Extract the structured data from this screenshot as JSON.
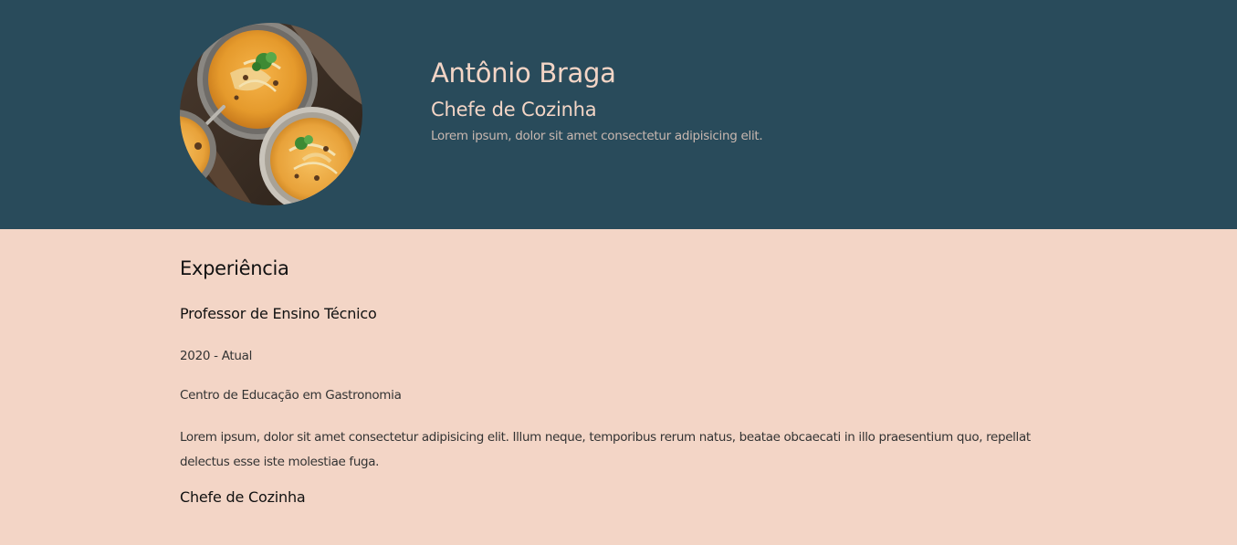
{
  "profile": {
    "photo_icon": "soup-bowls-photo",
    "name": "Antônio Braga",
    "role": "Chefe de Cozinha",
    "tagline": "Lorem ipsum, dolor sit amet consectetur adipisicing elit."
  },
  "experience": {
    "title": "Experiência",
    "jobs": [
      {
        "title": "Professor de Ensino Técnico",
        "period": "2020 - Atual",
        "place": "Centro de Educação em Gastronomia",
        "description": "Lorem ipsum, dolor sit amet consectetur adipisicing elit. Illum neque, temporibus rerum natus, beatae obcaecati in illo praesentium quo, repellat delectus esse iste molestiae fuga."
      },
      {
        "title": "Chefe de Cozinha"
      }
    ]
  },
  "colors": {
    "header_bg": "#294b5b",
    "body_bg": "#f3d5c6",
    "header_text": "#f3d5c6"
  }
}
